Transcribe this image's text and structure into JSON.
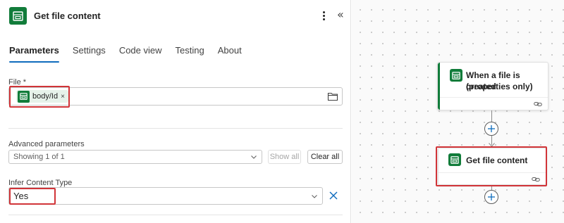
{
  "panel": {
    "title": "Get file content",
    "tabs": [
      {
        "label": "Parameters",
        "active": true
      },
      {
        "label": "Settings",
        "active": false
      },
      {
        "label": "Code view",
        "active": false
      },
      {
        "label": "Testing",
        "active": false
      },
      {
        "label": "About",
        "active": false
      }
    ],
    "file_field": {
      "label": "File *",
      "token": "body/Id"
    },
    "advanced": {
      "label": "Advanced parameters",
      "dropdown_value": "Showing 1 of 1",
      "show_all": "Show all",
      "clear_all": "Clear all"
    },
    "infer": {
      "label": "Infer Content Type",
      "value": "Yes"
    }
  },
  "canvas": {
    "trigger_card": {
      "title_line1": "When a file is created",
      "title_line2": "(properties only)"
    },
    "action_card": {
      "title": "Get file content"
    }
  },
  "colors": {
    "brand": "#117c3a",
    "accent": "#0f6cbd",
    "highlight": "#d13438"
  },
  "icons": [
    "sharepoint-icon",
    "more-options-icon",
    "collapse-panel-icon",
    "folder-icon",
    "chevron-down-icon",
    "clear-icon",
    "link-icon",
    "add-step-icon"
  ]
}
